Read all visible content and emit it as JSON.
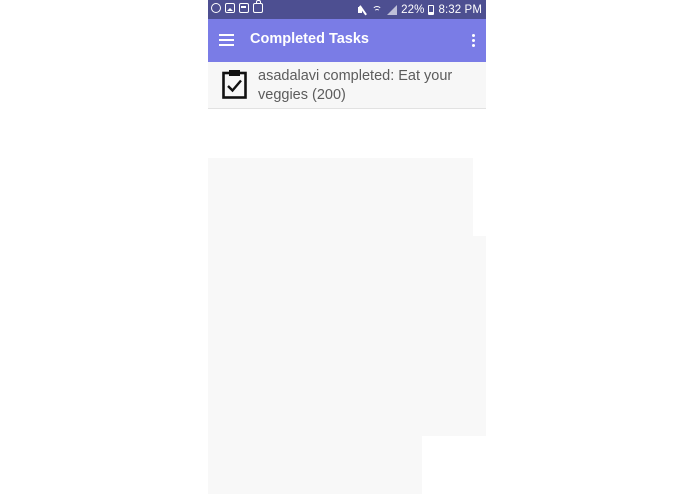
{
  "status_bar": {
    "battery_text": "22%",
    "time": "8:32 PM",
    "notification_icons": [
      "whatsapp-icon",
      "image-icon",
      "message-icon",
      "bag-icon"
    ],
    "background_color": "#4d4f91"
  },
  "app_bar": {
    "title": "Completed Tasks",
    "menu_icon": "hamburger-menu-icon",
    "overflow_icon": "more-vertical-icon",
    "background_color": "#7a7ce6"
  },
  "tasks": [
    {
      "icon": "clipboard-check-icon",
      "text": "asadalavi completed: Eat your veggies (200)"
    }
  ]
}
